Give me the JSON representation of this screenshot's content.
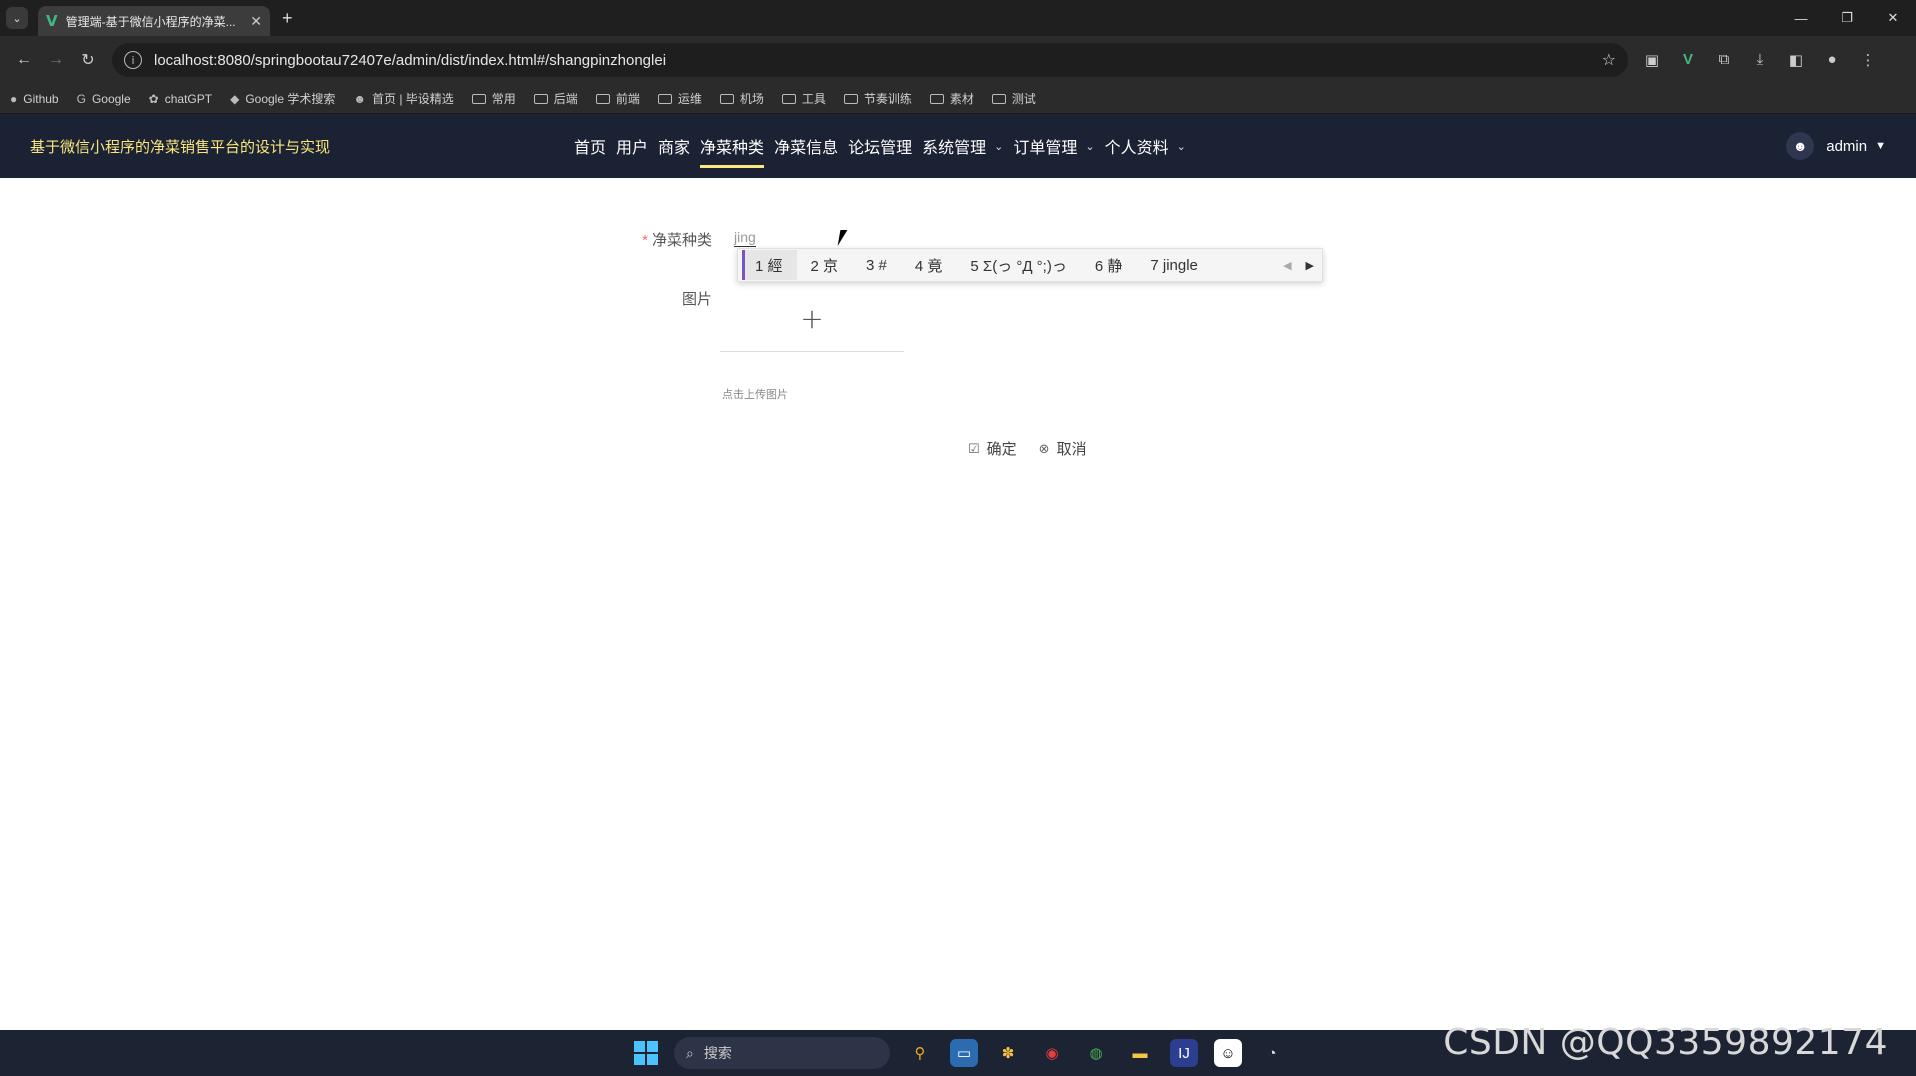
{
  "browser": {
    "tab_title": "管理端-基于微信小程序的净菜...",
    "url": "localhost:8080/springbootau72407e/admin/dist/index.html#/shangpinzhonglei",
    "bookmarks": [
      "Github",
      "Google",
      "chatGPT",
      "Google 学术搜索",
      "首页 | 毕设精选",
      "常用",
      "后端",
      "前端",
      "运维",
      "机场",
      "工具",
      "节奏训练",
      "素材",
      "测试"
    ]
  },
  "header": {
    "brand": "基于微信小程序的净菜销售平台的设计与实现",
    "nav": [
      {
        "label": "首页"
      },
      {
        "label": "用户"
      },
      {
        "label": "商家"
      },
      {
        "label": "净菜种类"
      },
      {
        "label": "净菜信息"
      },
      {
        "label": "论坛管理"
      },
      {
        "label": "系统管理"
      },
      {
        "label": "订单管理"
      },
      {
        "label": "个人资料"
      }
    ],
    "user": "admin"
  },
  "form": {
    "category_label": "净菜种类",
    "category_value": "jing",
    "image_label": "图片",
    "upload_hint": "点击上传图片",
    "confirm_label": "确定",
    "cancel_label": "取消"
  },
  "ime": {
    "candidates": [
      "1 經",
      "2 京",
      "3 #",
      "4 竟",
      "5 Σ(っ °Д °;)っ",
      "6 静",
      "7 jingle"
    ]
  },
  "taskbar": {
    "search_placeholder": "搜索"
  },
  "watermark": "CSDN @QQ3359892174"
}
